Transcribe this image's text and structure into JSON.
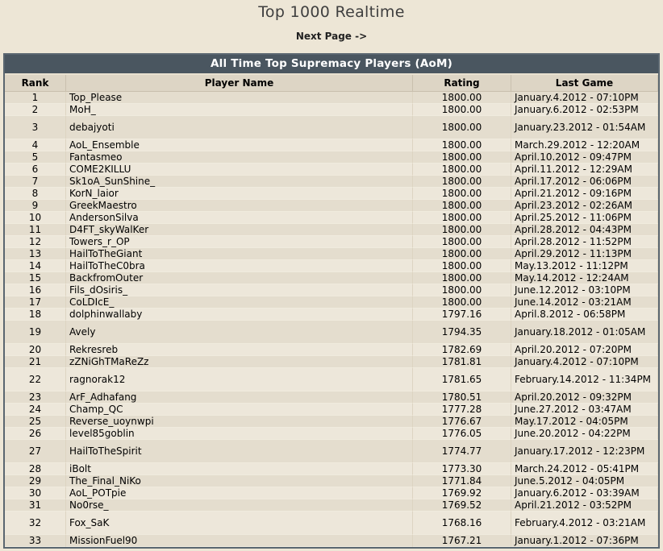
{
  "header": {
    "title": "Top 1000 Realtime",
    "next_page": "Next Page ->"
  },
  "board": {
    "title": "All Time Top Supremacy Players (AoM)",
    "columns": [
      "Rank",
      "Player Name",
      "Rating",
      "Last Game"
    ],
    "rows": [
      {
        "rank": "1",
        "player": "Top_Please",
        "rating": "1800.00",
        "last": "January.4.2012 - 07:10PM"
      },
      {
        "rank": "2",
        "player": "MoH_",
        "rating": "1800.00",
        "last": "January.6.2012 - 02:53PM"
      },
      {
        "rank": "3",
        "player": "debajyoti",
        "rating": "1800.00",
        "last": "January.23.2012 - 01:54AM"
      },
      {
        "rank": "4",
        "player": "AoL_Ensemble",
        "rating": "1800.00",
        "last": "March.29.2012 - 12:20AM"
      },
      {
        "rank": "5",
        "player": "Fantasmeo",
        "rating": "1800.00",
        "last": "April.10.2012 - 09:47PM"
      },
      {
        "rank": "6",
        "player": "COME2KILLU",
        "rating": "1800.00",
        "last": "April.11.2012 - 12:29AM"
      },
      {
        "rank": "7",
        "player": "Sk1oA_SunShine_",
        "rating": "1800.00",
        "last": "April.17.2012 - 06:06PM"
      },
      {
        "rank": "8",
        "player": "KorN_laior",
        "rating": "1800.00",
        "last": "April.21.2012 - 09:16PM"
      },
      {
        "rank": "9",
        "player": "GreekMaestro",
        "rating": "1800.00",
        "last": "April.23.2012 - 02:26AM"
      },
      {
        "rank": "10",
        "player": "AndersonSilva",
        "rating": "1800.00",
        "last": "April.25.2012 - 11:06PM"
      },
      {
        "rank": "11",
        "player": "D4FT_skyWalKer",
        "rating": "1800.00",
        "last": "April.28.2012 - 04:43PM"
      },
      {
        "rank": "12",
        "player": "Towers_r_OP",
        "rating": "1800.00",
        "last": "April.28.2012 - 11:52PM"
      },
      {
        "rank": "13",
        "player": "HailToTheGiant",
        "rating": "1800.00",
        "last": "April.29.2012 - 11:13PM"
      },
      {
        "rank": "14",
        "player": "HailToTheC0bra",
        "rating": "1800.00",
        "last": "May.13.2012 - 11:12PM"
      },
      {
        "rank": "15",
        "player": "BackfromOuter",
        "rating": "1800.00",
        "last": "May.14.2012 - 12:24AM"
      },
      {
        "rank": "16",
        "player": "Fils_dOsiris_",
        "rating": "1800.00",
        "last": "June.12.2012 - 03:10PM"
      },
      {
        "rank": "17",
        "player": "CoLDIcE_",
        "rating": "1800.00",
        "last": "June.14.2012 - 03:21AM"
      },
      {
        "rank": "18",
        "player": "dolphinwallaby",
        "rating": "1797.16",
        "last": "April.8.2012 - 06:58PM"
      },
      {
        "rank": "19",
        "player": "Avely",
        "rating": "1794.35",
        "last": "January.18.2012 - 01:05AM"
      },
      {
        "rank": "20",
        "player": "Rekresreb",
        "rating": "1782.69",
        "last": "April.20.2012 - 07:20PM"
      },
      {
        "rank": "21",
        "player": "zZNiGhTMaReZz",
        "rating": "1781.81",
        "last": "January.4.2012 - 07:10PM"
      },
      {
        "rank": "22",
        "player": "ragnorak12",
        "rating": "1781.65",
        "last": "February.14.2012 - 11:34PM"
      },
      {
        "rank": "23",
        "player": "ArF_Adhafang",
        "rating": "1780.51",
        "last": "April.20.2012 - 09:32PM"
      },
      {
        "rank": "24",
        "player": "Champ_QC",
        "rating": "1777.28",
        "last": "June.27.2012 - 03:47AM"
      },
      {
        "rank": "25",
        "player": "Reverse_uoynwpi",
        "rating": "1776.67",
        "last": "May.17.2012 - 04:05PM"
      },
      {
        "rank": "26",
        "player": "level85goblin",
        "rating": "1776.05",
        "last": "June.20.2012 - 04:22PM"
      },
      {
        "rank": "27",
        "player": "HailToTheSpirit",
        "rating": "1774.77",
        "last": "January.17.2012 - 12:23PM"
      },
      {
        "rank": "28",
        "player": "iBolt",
        "rating": "1773.30",
        "last": "March.24.2012 - 05:41PM"
      },
      {
        "rank": "29",
        "player": "The_Final_NiKo",
        "rating": "1771.84",
        "last": "June.5.2012 - 04:05PM"
      },
      {
        "rank": "30",
        "player": "AoL_POTpie",
        "rating": "1769.92",
        "last": "January.6.2012 - 03:39AM"
      },
      {
        "rank": "31",
        "player": "No0rse_",
        "rating": "1769.52",
        "last": "April.21.2012 - 03:52PM"
      },
      {
        "rank": "32",
        "player": "Fox_SaK",
        "rating": "1768.16",
        "last": "February.4.2012 - 03:21AM"
      },
      {
        "rank": "33",
        "player": "MissionFuel90",
        "rating": "1767.21",
        "last": "January.1.2012 - 07:36PM"
      }
    ]
  }
}
